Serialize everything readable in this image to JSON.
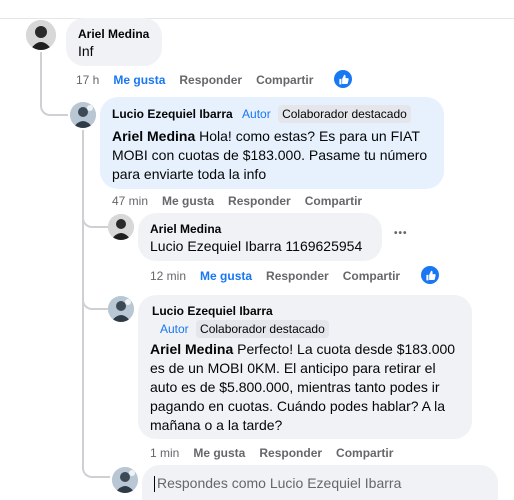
{
  "top_line": "",
  "comments": [
    {
      "author": "Ariel Medina",
      "text": "Inf",
      "time": "17 h",
      "like": "Me gusta",
      "reply": "Responder",
      "share": "Compartir"
    },
    {
      "author": "Lucio Ezequiel Ibarra",
      "role": "Autor",
      "badge": "Colaborador destacado",
      "mention": "Ariel Medina",
      "text": " Hola! como estas? Es para un FIAT MOBI con cuotas de $183.000. Pasame tu número para enviarte toda la info",
      "time": "47 min",
      "like": "Me gusta",
      "reply": "Responder",
      "share": "Compartir"
    },
    {
      "author": "Ariel Medina",
      "text": "Lucio Ezequiel Ibarra 1169625954",
      "time": "12 min",
      "like": "Me gusta",
      "reply": "Responder",
      "share": "Compartir",
      "more": "•••"
    },
    {
      "author": "Lucio Ezequiel Ibarra",
      "role": "Autor",
      "badge": "Colaborador destacado",
      "mention": "Ariel Medina",
      "text": " Perfecto! La cuota desde $183.000 es de un MOBI 0KM. El anticipo para retirar el auto es de $5.800.000, mientras tanto podes ir pagando en cuotas. Cuándo podes hablar? A la mañana o a la tarde?",
      "time": "1 min",
      "like": "Me gusta",
      "reply": "Responder",
      "share": "Compartir"
    }
  ],
  "reply_input": {
    "placeholder": "Respondes como Lucio Ezequiel Ibarra"
  },
  "colors": {
    "accent": "#1877f2",
    "bubble": "#f0f2f5",
    "highlight_bubble": "#e7f1fd",
    "muted": "#65676b"
  }
}
